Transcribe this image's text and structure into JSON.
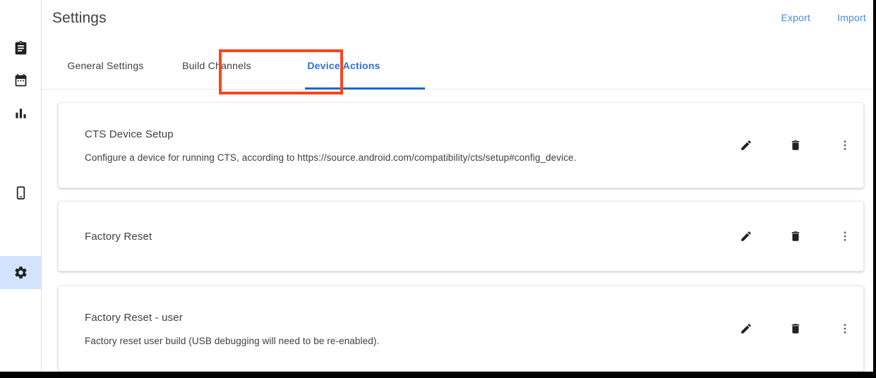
{
  "sidebar": {
    "items": [
      {
        "name": "clipboard",
        "icon": "clipboard-icon",
        "selected": false
      },
      {
        "name": "calendar",
        "icon": "calendar-icon",
        "selected": false
      },
      {
        "name": "analytics",
        "icon": "bar-chart-icon",
        "selected": false
      },
      {
        "name": "devices",
        "icon": "smartphone-icon",
        "selected": false
      },
      {
        "name": "settings",
        "icon": "gear-icon",
        "selected": true
      }
    ],
    "selected_color": "#d3e3fd"
  },
  "header": {
    "title": "Settings",
    "export_label": "Export",
    "import_label": "Import",
    "link_color": "#3f8cf0"
  },
  "tabs": {
    "items": [
      {
        "label": "General Settings",
        "active": false
      },
      {
        "label": "Build Channels",
        "active": false
      },
      {
        "label": "Device Actions",
        "active": true
      }
    ],
    "active_index": 2,
    "active_color": "#2b6fe3",
    "underline_color": "#1a67d2"
  },
  "annotation": {
    "target": "Device Actions",
    "color": "#f8461d"
  },
  "device_actions": {
    "cards": [
      {
        "title": "CTS Device Setup",
        "description": "Configure a device for running CTS, according to https://source.android.com/compatibility/cts/setup#config_device.",
        "edit_label": "edit-icon",
        "delete_label": "trash-icon",
        "more_label": "more-vert-icon"
      },
      {
        "title": "Factory Reset",
        "description": "",
        "edit_label": "edit-icon",
        "delete_label": "trash-icon",
        "more_label": "more-vert-icon"
      },
      {
        "title": "Factory Reset - user",
        "description": "Factory reset user build (USB debugging will need to be re-enabled).",
        "edit_label": "edit-icon",
        "delete_label": "trash-icon",
        "more_label": "more-vert-icon"
      }
    ]
  }
}
